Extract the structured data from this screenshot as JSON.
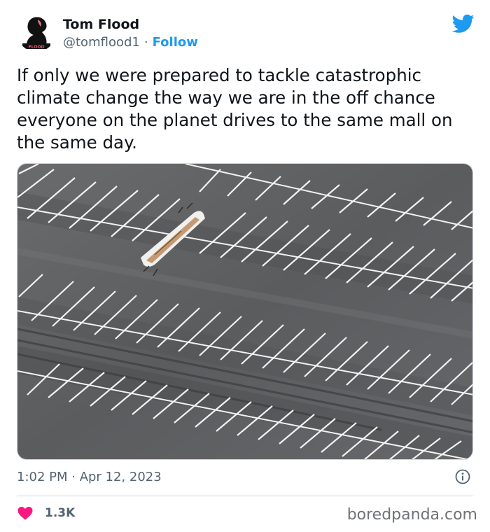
{
  "author": {
    "display_name": "Tom Flood",
    "handle": "@tomflood1",
    "follow_label": "Follow",
    "avatar_icon": "black-silhouette-avatar",
    "avatar_text": "FLOOD"
  },
  "tweet": {
    "text": "If only we were prepared to tackle catastrophic climate change the way we are in the off chance everyone on the planet drives to the same mall on the same day.",
    "timestamp": "1:02 PM · Apr 12, 2023",
    "like_count": "1.3K"
  },
  "media": {
    "description_icon": "aerial-empty-parking-lot-photo"
  },
  "icons": {
    "brand": "twitter-bird-icon",
    "info": "info-icon",
    "like": "heart-icon"
  },
  "watermark": "boredpanda.com",
  "colors": {
    "accent": "#1d9bf0",
    "like": "#f91880",
    "muted": "#536471",
    "asphalt": "#5f6062"
  }
}
